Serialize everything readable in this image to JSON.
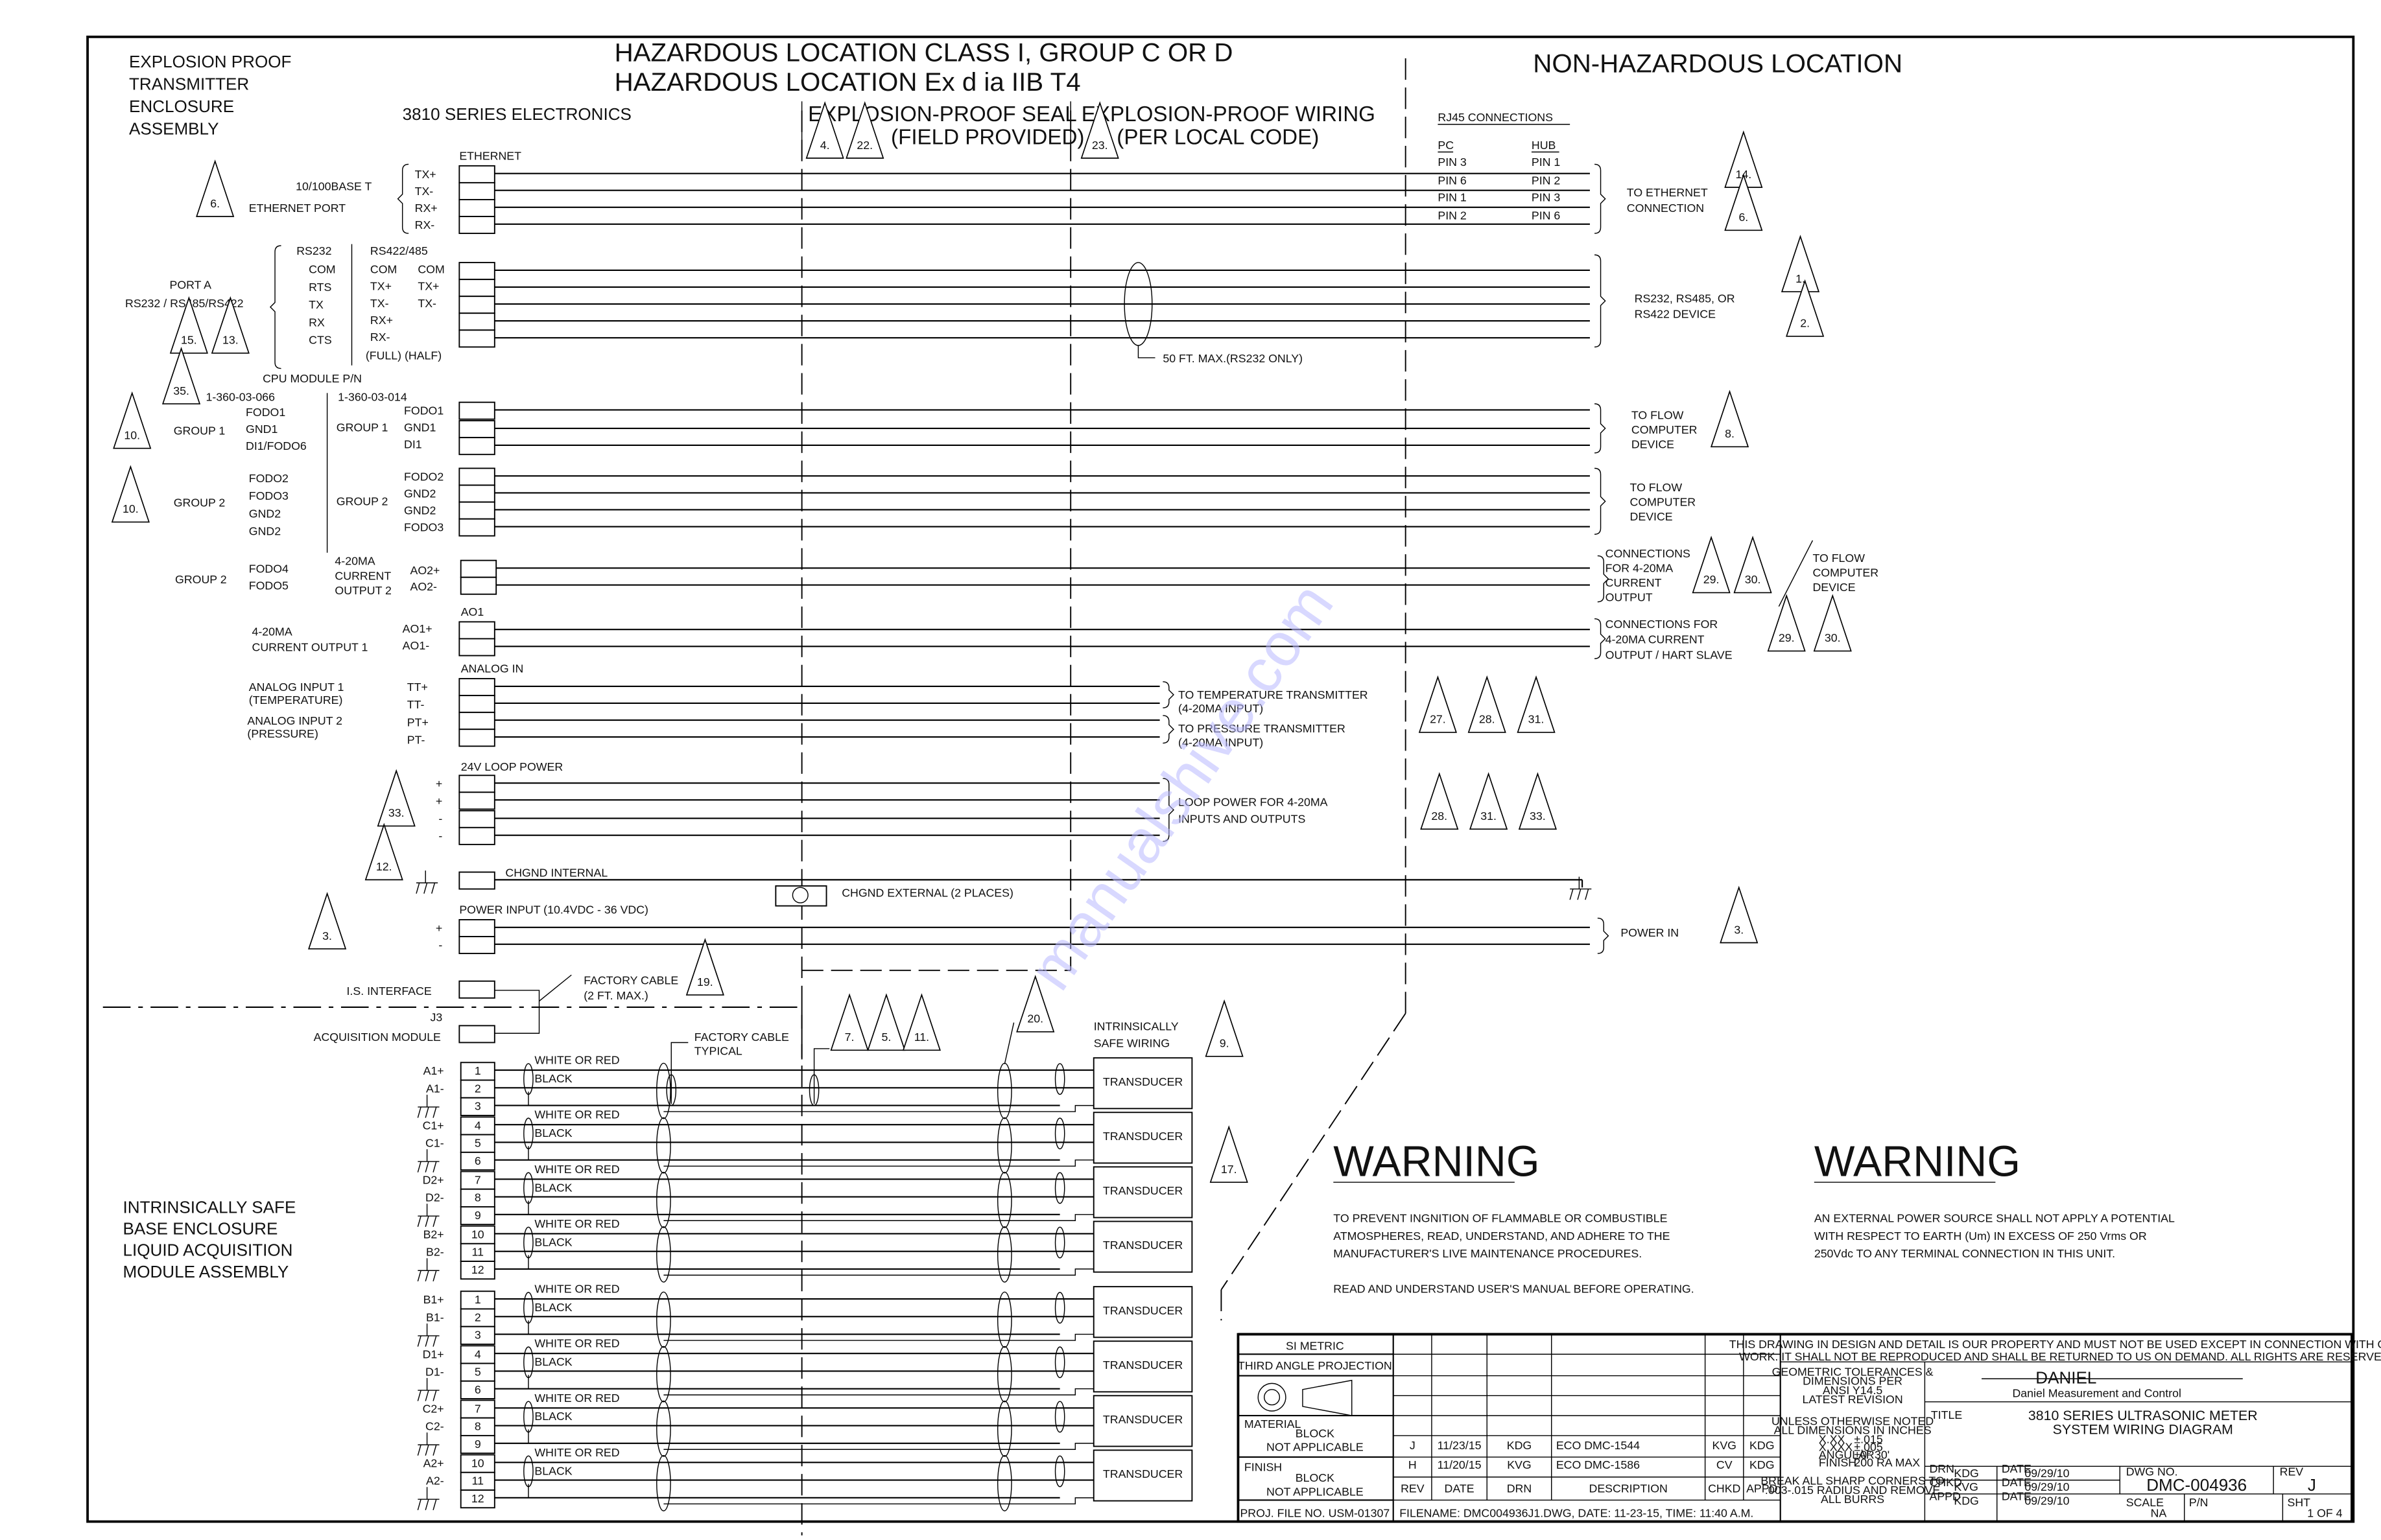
{
  "header": {
    "left_title": [
      "EXPLOSION PROOF",
      "TRANSMITTER",
      "ENCLOSURE",
      "ASSEMBLY"
    ],
    "hazard_line1": "HAZARDOUS LOCATION CLASS I, GROUP C OR D",
    "hazard_line2": "HAZARDOUS LOCATION Ex d ia IIB T4",
    "non_hazard": "NON-HAZARDOUS LOCATION",
    "electronics": "3810 SERIES ELECTRONICS",
    "seal_label": "EXPLOSION-PROOF SEAL",
    "seal_sub": "(FIELD PROVIDED)",
    "wiring_label": "EXPLOSION-PROOF WIRING",
    "wiring_sub": "(PER LOCAL CODE)",
    "seal_notes": [
      "4.",
      "22."
    ],
    "wiring_notes": [
      "23."
    ]
  },
  "ethernet": {
    "header": "ETHERNET",
    "port_label1": "10/100BASE T",
    "port_label2": "ETHERNET PORT",
    "note": "6.",
    "pins": [
      "TX+",
      "TX-",
      "RX+",
      "RX-"
    ],
    "rj45_title": "RJ45 CONNECTIONS",
    "pc_header": "PC",
    "hub_header": "HUB",
    "pc_pins": [
      "PIN 3",
      "PIN 6",
      "PIN 1",
      "PIN 2"
    ],
    "hub_pins": [
      "PIN 1",
      "PIN 2",
      "PIN 3",
      "PIN 6"
    ],
    "dest": [
      "TO ETHERNET",
      "CONNECTION"
    ],
    "dest_notes": [
      "14.",
      "6."
    ]
  },
  "serial": {
    "port_label1": "PORT A",
    "port_label2": "RS232 / RS485/RS422",
    "notes": [
      "15.",
      "13."
    ],
    "rs232_header": "RS232",
    "rs232_pins": [
      "COM",
      "RTS",
      "TX",
      "RX",
      "CTS"
    ],
    "rs422_header": "RS422/485",
    "full_pins": [
      "COM",
      "TX+",
      "TX-",
      "RX+",
      "RX-"
    ],
    "half_pins": [
      "COM",
      "TX+",
      "TX-",
      "",
      ""
    ],
    "full_half": "(FULL) (HALF)",
    "cable_note": "50 FT. MAX.(RS232 ONLY)",
    "dest": [
      "RS232, RS485, OR",
      "RS422 DEVICE"
    ],
    "dest_notes": [
      "1.",
      "2."
    ]
  },
  "cpu": {
    "title": "CPU MODULE P/N",
    "note": "35.",
    "pn_old": "1-360-03-066",
    "pn_new": "1-360-03-014",
    "group1_note": "10.",
    "group1_label": "GROUP 1",
    "group1_old": [
      "FODO1",
      "GND1",
      "DI1/FODO6"
    ],
    "group1_new": [
      "FODO1",
      "GND1",
      "DI1"
    ],
    "group2_note": "10.",
    "group2_label": "GROUP 2",
    "group2_old": [
      "FODO2",
      "FODO3",
      "GND2",
      "GND2"
    ],
    "group2_new": [
      "FODO2",
      "GND2",
      "GND2",
      "FODO3"
    ],
    "group2b_label": "GROUP 2",
    "group2b_old": [
      "FODO4",
      "FODO5"
    ],
    "ao2_label": [
      "4-20MA",
      "CURRENT",
      "OUTPUT 2"
    ],
    "ao2_pins": [
      "AO2+",
      "AO2-"
    ],
    "flow1_dest": [
      "TO FLOW",
      "COMPUTER",
      "DEVICE"
    ],
    "flow1_note": "8.",
    "flow2_dest": [
      "TO FLOW",
      "COMPUTER",
      "DEVICE"
    ],
    "ao2_dest": [
      "CONNECTIONS",
      "FOR 4-20MA",
      "CURRENT",
      "OUTPUT"
    ],
    "ao2_notes": [
      "29.",
      "30."
    ],
    "ao2_alt": [
      "TO FLOW",
      "COMPUTER",
      "DEVICE"
    ]
  },
  "ao1": {
    "header": "AO1",
    "label": [
      "4-20MA",
      "CURRENT OUTPUT 1"
    ],
    "pins": [
      "AO1+",
      "AO1-"
    ],
    "dest": [
      "CONNECTIONS FOR",
      "4-20MA CURRENT",
      "OUTPUT / HART SLAVE"
    ],
    "notes": [
      "29.",
      "30."
    ]
  },
  "analog": {
    "header": "ANALOG IN",
    "in1": [
      "ANALOG INPUT 1",
      "(TEMPERATURE)"
    ],
    "in2": [
      "ANALOG INPUT 2",
      "(PRESSURE)"
    ],
    "pins": [
      "TT+",
      "TT-",
      "PT+",
      "PT-"
    ],
    "dest_temp": [
      "TO TEMPERATURE TRANSMITTER",
      "(4-20MA INPUT)"
    ],
    "dest_press": [
      "TO PRESSURE TRANSMITTER",
      "(4-20MA INPUT)"
    ],
    "notes": [
      "27.",
      "28.",
      "31."
    ]
  },
  "loop": {
    "header": "24V LOOP POWER",
    "pins": [
      "+",
      "+",
      "-",
      "-"
    ],
    "note": "33.",
    "dest": [
      "LOOP POWER FOR 4-20MA",
      "INPUTS AND OUTPUTS"
    ],
    "dest_notes": [
      "28.",
      "31.",
      "33."
    ]
  },
  "ground": {
    "note": "12.",
    "internal": "CHGND INTERNAL",
    "external": "CHGND EXTERNAL (2 PLACES)"
  },
  "power": {
    "header": "POWER INPUT (10.4VDC - 36 VDC)",
    "note": "3.",
    "pins": [
      "+",
      "-"
    ],
    "dest": "POWER IN",
    "dest_note": "3."
  },
  "is": {
    "interface": "I.S. INTERFACE",
    "j3": "J3",
    "acq": "ACQUISITION MODULE",
    "factory_cable": [
      "FACTORY CABLE",
      "(2 FT. MAX.)"
    ],
    "factory_note": "19.",
    "factory_typical": [
      "FACTORY CABLE",
      "TYPICAL"
    ],
    "typical_notes": [
      "7.",
      "5.",
      "11."
    ],
    "note20": "20.",
    "is_wiring": [
      "INTRINSICALLY",
      "SAFE WIRING"
    ],
    "is_note": "9.",
    "note17": "17.",
    "base_title": [
      "INTRINSICALLY SAFE",
      "BASE ENCLOSURE",
      "LIQUID ACQUISITION",
      "MODULE ASSEMBLY"
    ],
    "wire_labels": [
      "WHITE OR RED",
      "BLACK"
    ],
    "transducer": "TRANSDUCER",
    "block1": [
      {
        "labels": [
          "A1+",
          "A1-",
          "GND"
        ],
        "nums": [
          "1",
          "2",
          "3"
        ]
      },
      {
        "labels": [
          "C1+",
          "C1-",
          "GND"
        ],
        "nums": [
          "4",
          "5",
          "6"
        ]
      },
      {
        "labels": [
          "D2+",
          "D2-",
          "GND"
        ],
        "nums": [
          "7",
          "8",
          "9"
        ]
      },
      {
        "labels": [
          "B2+",
          "B2-",
          "GND"
        ],
        "nums": [
          "10",
          "11",
          "12"
        ]
      }
    ],
    "block2": [
      {
        "labels": [
          "B1+",
          "B1-",
          "GND"
        ],
        "nums": [
          "1",
          "2",
          "3"
        ]
      },
      {
        "labels": [
          "D1+",
          "D1-",
          "GND"
        ],
        "nums": [
          "4",
          "5",
          "6"
        ]
      },
      {
        "labels": [
          "C2+",
          "C2-",
          "GND"
        ],
        "nums": [
          "7",
          "8",
          "9"
        ]
      },
      {
        "labels": [
          "A2+",
          "A2-",
          "GND"
        ],
        "nums": [
          "10",
          "11",
          "12"
        ]
      }
    ]
  },
  "warnings": [
    {
      "title": "WARNING",
      "lines": [
        "TO PREVENT INGNITION OF FLAMMABLE OR COMBUSTIBLE",
        "ATMOSPHERES, READ, UNDERSTAND, AND ADHERE TO THE",
        "MANUFACTURER'S LIVE MAINTENANCE PROCEDURES.",
        "",
        "READ AND UNDERSTAND USER'S MANUAL BEFORE OPERATING."
      ]
    },
    {
      "title": "WARNING",
      "lines": [
        "AN EXTERNAL POWER SOURCE SHALL NOT APPLY A POTENTIAL",
        "WITH RESPECT TO EARTH (Um) IN EXCESS OF 250 Vrms OR",
        "250Vdc TO ANY TERMINAL CONNECTION IN THIS UNIT."
      ]
    }
  ],
  "titleblock": {
    "si_metric": "SI METRIC",
    "projection": "THIRD ANGLE PROJECTION",
    "material_label": "MATERIAL",
    "material": [
      "BLOCK",
      "NOT APPLICABLE"
    ],
    "finish_label": "FINISH",
    "finish": [
      "BLOCK",
      "NOT APPLICABLE"
    ],
    "proj_file": "PROJ. FILE NO. USM-01307",
    "rev_headers": [
      "REV",
      "DATE",
      "DRN",
      "DESCRIPTION",
      "CHKD",
      "APPD"
    ],
    "revisions": [
      [
        "J",
        "11/23/15",
        "KDG",
        "ECO DMC-1544",
        "KVG",
        "KDG"
      ],
      [
        "H",
        "11/20/15",
        "KVG",
        "ECO DMC-1586",
        "CV",
        "KDG"
      ]
    ],
    "filename": "FILENAME: DMC004936J1.DWG, DATE: 11-23-15, TIME: 11:40 A.M.",
    "property": [
      "THIS DRAWING IN DESIGN AND DETAIL IS OUR PROPERTY AND MUST NOT BE USED EXCEPT IN CONNECTION WITH OUR",
      "WORK. IT SHALL NOT BE REPRODUCED AND SHALL BE RETURNED TO US ON DEMAND. ALL RIGHTS ARE RESERVED."
    ],
    "tolerances": [
      "GEOMETRIC TOLERANCES &",
      "DIMENSIONS PER",
      "ANSI Y14.5",
      "LATEST REVISION"
    ],
    "units": [
      "UNLESS OTHERWISE NOTED",
      "ALL DIMENSIONS IN INCHES"
    ],
    "tol_table": [
      [
        "X.XX",
        "±.015"
      ],
      [
        "X.XXX",
        "±.005"
      ],
      [
        "ANGULAR",
        "±0° 30'"
      ],
      [
        "FINISH",
        "200 RA MAX"
      ]
    ],
    "break": [
      "BREAK ALL SHARP CORNERS TO",
      ".003-.015 RADIUS AND REMOVE",
      "ALL BURRS"
    ],
    "company": "DANIEL",
    "company_sub": "Daniel Measurement and Control",
    "title_label": "TITLE",
    "title": [
      "3810 SERIES ULTRASONIC METER",
      "SYSTEM WIRING DIAGRAM"
    ],
    "drn_label": "DRN",
    "drn": "KDG",
    "chkd_label": "CHKD",
    "chkd": "KVG",
    "appd_label": "APPD",
    "appd": "KDG",
    "date_label": "DATE",
    "dates": [
      "09/29/10",
      "09/29/10",
      "09/29/10"
    ],
    "dwg_label": "DWG NO.",
    "dwg_no": "DMC-004936",
    "rev_label": "REV",
    "rev": "J",
    "scale_label": "SCALE",
    "scale": "NA",
    "pn_label": "P/N",
    "sht_label": "SHT",
    "sheet": "1 OF 4"
  },
  "watermark": "manualshive.com"
}
